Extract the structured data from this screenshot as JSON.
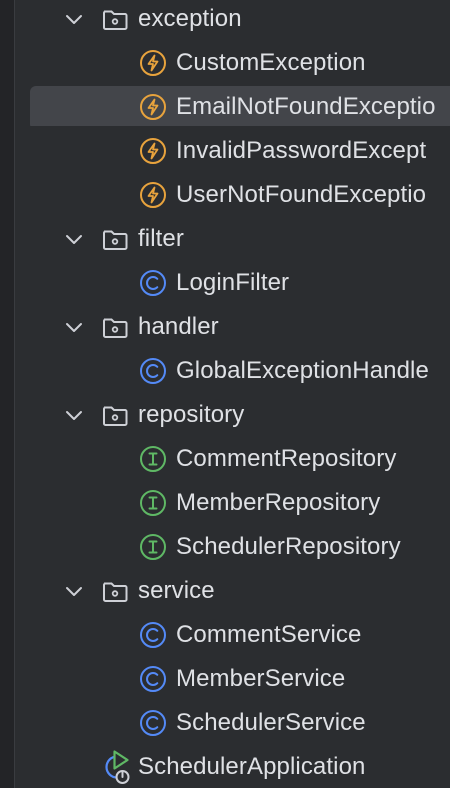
{
  "colors": {
    "background": "#2b2d30",
    "selection": "#43454a",
    "text": "#dfe1e5",
    "folder_icon": "#ced0d6",
    "exception_icon": "#e8a33d",
    "class_icon": "#548af7",
    "interface_icon": "#5fb865",
    "run_icon": "#5fb865"
  },
  "tree": {
    "items": [
      {
        "label": "exception",
        "icon": "folder-icon",
        "type": "folder",
        "expanded": true
      },
      {
        "label": "CustomException",
        "icon": "exception-class-icon",
        "type": "exception"
      },
      {
        "label": "EmailNotFoundExceptio",
        "icon": "exception-class-icon",
        "type": "exception",
        "selected": true
      },
      {
        "label": "InvalidPasswordExcept",
        "icon": "exception-class-icon",
        "type": "exception"
      },
      {
        "label": "UserNotFoundExceptio",
        "icon": "exception-class-icon",
        "type": "exception"
      },
      {
        "label": "filter",
        "icon": "folder-icon",
        "type": "folder",
        "expanded": true
      },
      {
        "label": "LoginFilter",
        "icon": "class-icon",
        "type": "class"
      },
      {
        "label": "handler",
        "icon": "folder-icon",
        "type": "folder",
        "expanded": true
      },
      {
        "label": "GlobalExceptionHandle",
        "icon": "class-icon",
        "type": "class"
      },
      {
        "label": "repository",
        "icon": "folder-icon",
        "type": "folder",
        "expanded": true
      },
      {
        "label": "CommentRepository",
        "icon": "interface-icon",
        "type": "interface"
      },
      {
        "label": "MemberRepository",
        "icon": "interface-icon",
        "type": "interface"
      },
      {
        "label": "SchedulerRepository",
        "icon": "interface-icon",
        "type": "interface"
      },
      {
        "label": "service",
        "icon": "folder-icon",
        "type": "folder",
        "expanded": true
      },
      {
        "label": "CommentService",
        "icon": "class-icon",
        "type": "class"
      },
      {
        "label": "MemberService",
        "icon": "class-icon",
        "type": "class"
      },
      {
        "label": "SchedulerService",
        "icon": "class-icon",
        "type": "class"
      },
      {
        "label": "SchedulerApplication",
        "icon": "spring-boot-app-icon",
        "type": "application"
      }
    ]
  }
}
